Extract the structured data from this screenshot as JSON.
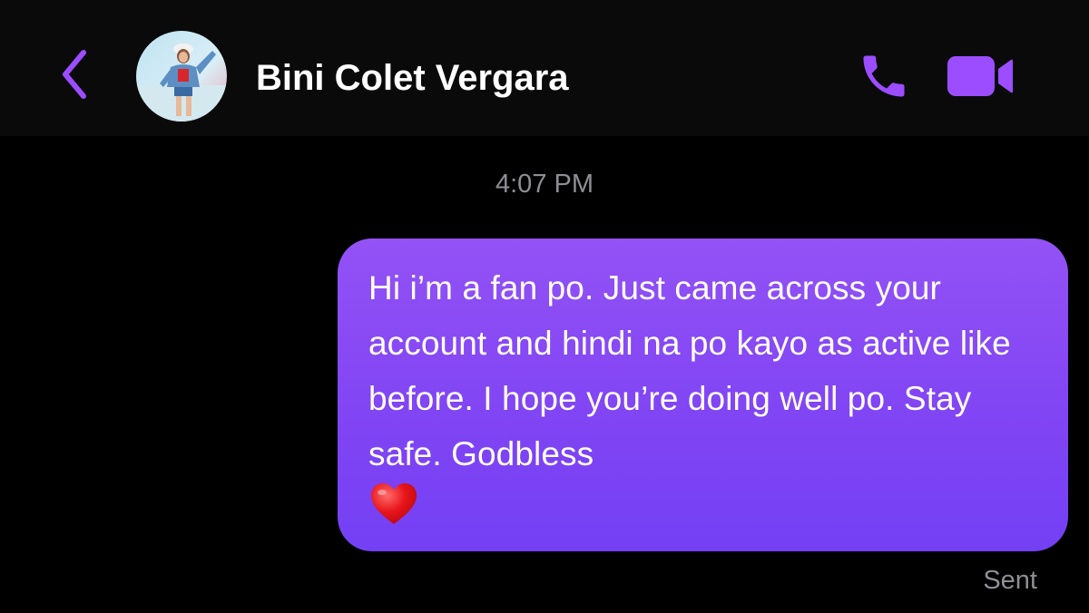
{
  "header": {
    "contact_name": "Bini Colet Vergara",
    "back_icon": "chevron-left-icon",
    "call_icon": "phone-icon",
    "video_icon": "video-camera-icon",
    "accent_color": "#9b4dff"
  },
  "conversation": {
    "timestamp": "4:07 PM",
    "messages": [
      {
        "sender": "me",
        "text": "Hi i’m a fan po. Just came across your account and hindi na po kayo as active like before. I hope you’re doing well po. Stay safe. Godbless",
        "emoji": "heart-emoji",
        "bubble_color": "#8a4af5"
      }
    ],
    "status": "Sent"
  }
}
